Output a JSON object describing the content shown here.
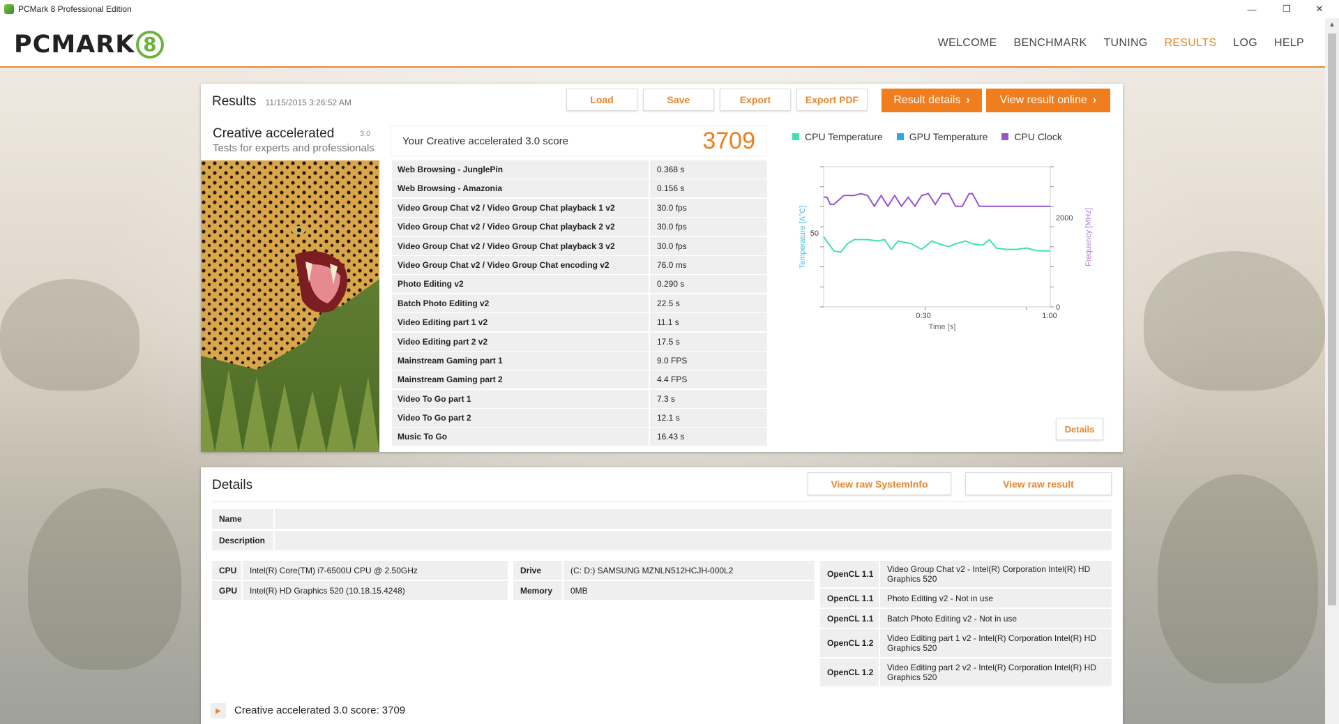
{
  "window": {
    "title": "PCMark 8 Professional Edition"
  },
  "logo": {
    "text": "PCMARK",
    "mark": "8"
  },
  "nav": {
    "items": [
      "WELCOME",
      "BENCHMARK",
      "TUNING",
      "RESULTS",
      "LOG",
      "HELP"
    ],
    "active": "RESULTS"
  },
  "results": {
    "title": "Results",
    "timestamp": "11/15/2015 3:26:52 AM",
    "buttons": {
      "load": "Load",
      "save": "Save",
      "export": "Export",
      "export_pdf": "Export PDF",
      "result_details": "Result details",
      "view_online": "View result online"
    },
    "test": {
      "name": "Creative accelerated",
      "version": "3.0",
      "subtitle": "Tests for experts and professionals"
    },
    "score": {
      "label": "Your Creative accelerated 3.0 score",
      "value": "3709"
    },
    "rows": [
      {
        "name": "Web Browsing - JunglePin",
        "value": "0.368 s"
      },
      {
        "name": "Web Browsing - Amazonia",
        "value": "0.156 s"
      },
      {
        "name": "Video Group Chat v2 / Video Group Chat playback 1 v2",
        "value": "30.0 fps"
      },
      {
        "name": "Video Group Chat v2 / Video Group Chat playback 2 v2",
        "value": "30.0 fps"
      },
      {
        "name": "Video Group Chat v2 / Video Group Chat playback 3 v2",
        "value": "30.0 fps"
      },
      {
        "name": "Video Group Chat v2 / Video Group Chat encoding v2",
        "value": "76.0 ms"
      },
      {
        "name": "Photo Editing v2",
        "value": "0.290 s"
      },
      {
        "name": "Batch Photo Editing v2",
        "value": "22.5 s"
      },
      {
        "name": "Video Editing part 1 v2",
        "value": "11.1 s"
      },
      {
        "name": "Video Editing part 2 v2",
        "value": "17.5 s"
      },
      {
        "name": "Mainstream Gaming part 1",
        "value": "9.0 FPS"
      },
      {
        "name": "Mainstream Gaming part 2",
        "value": "4.4 FPS"
      },
      {
        "name": "Video To Go part 1",
        "value": "7.3 s"
      },
      {
        "name": "Video To Go part 2",
        "value": "12.1 s"
      },
      {
        "name": "Music To Go",
        "value": "16.43 s"
      }
    ],
    "chart_details_button": "Details"
  },
  "chart_data": {
    "type": "line",
    "legend": [
      "CPU Temperature",
      "GPU Temperature",
      "CPU Clock"
    ],
    "colors": {
      "CPU Temperature": "#3ee0b4",
      "GPU Temperature": "#2aa8e8",
      "CPU Clock": "#9b52cc"
    },
    "xlabel": "Time [s]",
    "ylabel_left": "Temperature [A°C]",
    "ylabel_right": "Frequency [MHz]",
    "x_ticks": [
      "0:30",
      "1:00"
    ],
    "y_left_ticks": [
      "50"
    ],
    "y_right_ticks": [
      "2000",
      "0"
    ],
    "xlim": [
      0,
      67
    ],
    "ylim_left": [
      0,
      100
    ],
    "ylim_right": [
      0,
      3900
    ],
    "series": [
      {
        "name": "CPU Temperature",
        "x": [
          0,
          3,
          5,
          7,
          9,
          13,
          16,
          18,
          20,
          22,
          24,
          26,
          29,
          32,
          34,
          37,
          39,
          42,
          44,
          47,
          49,
          51,
          54,
          57,
          60,
          63,
          65,
          67
        ],
        "y": [
          50,
          40,
          39,
          45,
          48,
          48,
          47,
          48,
          41,
          47,
          46,
          45,
          41,
          47,
          45,
          43,
          45,
          47,
          45,
          44,
          48,
          42,
          41,
          41,
          42,
          40,
          40,
          40
        ]
      },
      {
        "name": "CPU Clock",
        "x": [
          0,
          1,
          2,
          3,
          6,
          9,
          11,
          13,
          15,
          17,
          19,
          21,
          23,
          25,
          27,
          29,
          31,
          33,
          35,
          37,
          39,
          41,
          43,
          44,
          46,
          49,
          55,
          60,
          67
        ],
        "y": [
          3050,
          3050,
          2850,
          2850,
          3100,
          3100,
          3150,
          3100,
          2800,
          3100,
          2800,
          3100,
          2800,
          3050,
          2800,
          3100,
          3150,
          2850,
          3150,
          3150,
          2800,
          2800,
          3150,
          3150,
          2800,
          2800,
          2800,
          2800,
          2800
        ]
      }
    ]
  },
  "details": {
    "title": "Details",
    "buttons": {
      "raw_systeminfo": "View raw SystemInfo",
      "raw_result": "View raw result"
    },
    "name_label": "Name",
    "description_label": "Description",
    "cpu_label": "CPU",
    "cpu": "Intel(R) Core(TM) i7-6500U CPU @ 2.50GHz",
    "gpu_label": "GPU",
    "gpu": "Intel(R) HD Graphics 520 (10.18.15.4248)",
    "drive_label": "Drive",
    "drive": "(C: D:) SAMSUNG MZNLN512HCJH-000L2",
    "memory_label": "Memory",
    "memory": "0MB",
    "opencl": [
      {
        "label": "OpenCL 1.1",
        "value": "Video Group Chat v2 - Intel(R) Corporation Intel(R) HD Graphics 520"
      },
      {
        "label": "OpenCL 1.1",
        "value": "Photo Editing v2 - Not in use"
      },
      {
        "label": "OpenCL 1.1",
        "value": "Batch Photo Editing v2 - Not in use"
      },
      {
        "label": "OpenCL 1.2",
        "value": "Video Editing part 1 v2 - Intel(R) Corporation Intel(R) HD Graphics 520"
      },
      {
        "label": "OpenCL 1.2",
        "value": "Video Editing part 2 v2 - Intel(R) Corporation Intel(R) HD Graphics 520"
      }
    ],
    "score_summary": "Creative accelerated 3.0 score: 3709"
  }
}
